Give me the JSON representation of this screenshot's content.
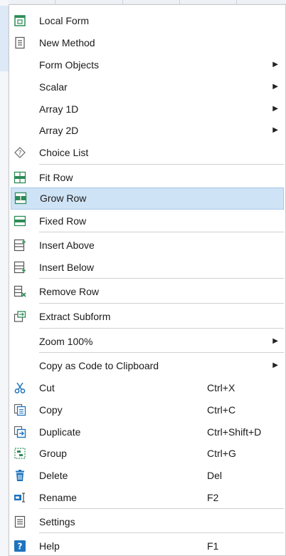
{
  "menu": {
    "local_form": "Local Form",
    "new_method": "New Method",
    "form_objects": "Form Objects",
    "scalar": "Scalar",
    "array_1d": "Array 1D",
    "array_2d": "Array 2D",
    "choice_list": "Choice List",
    "fit_row": "Fit Row",
    "grow_row": "Grow Row",
    "fixed_row": "Fixed Row",
    "insert_above": "Insert Above",
    "insert_below": "Insert Below",
    "remove_row": "Remove Row",
    "extract_subform": "Extract Subform",
    "zoom": "Zoom 100%",
    "copy_as_code": "Copy as Code to Clipboard",
    "cut": "Cut",
    "cut_shortcut": "Ctrl+X",
    "copy": "Copy",
    "copy_shortcut": "Ctrl+C",
    "duplicate": "Duplicate",
    "duplicate_shortcut": "Ctrl+Shift+D",
    "group": "Group",
    "group_shortcut": "Ctrl+G",
    "delete": "Delete",
    "delete_shortcut": "Del",
    "rename": "Rename",
    "rename_shortcut": "F2",
    "settings": "Settings",
    "help": "Help",
    "help_shortcut": "F1",
    "highlighted_item": "Grow Row"
  },
  "colors": {
    "icon_green": "#2e8b57",
    "icon_blue": "#1e73be",
    "highlight_bg": "#cfe3f6",
    "highlight_border": "#a8c8e8"
  },
  "icons": {
    "local_form": "form-icon",
    "new_method": "method-icon",
    "choice_list": "choice-list-icon",
    "fit_row": "fit-row-icon",
    "grow_row": "grow-row-icon",
    "fixed_row": "fixed-row-icon",
    "insert_above": "insert-above-icon",
    "insert_below": "insert-below-icon",
    "remove_row": "remove-row-icon",
    "extract_subform": "extract-subform-icon",
    "cut": "scissors-icon",
    "copy": "copy-icon",
    "duplicate": "duplicate-icon",
    "group": "group-icon",
    "delete": "trash-icon",
    "rename": "rename-icon",
    "settings": "settings-icon",
    "help": "help-icon"
  }
}
